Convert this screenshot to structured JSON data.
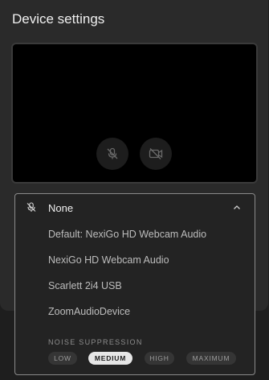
{
  "dialog": {
    "title": "Device settings"
  },
  "video_preview": {
    "mic_button_icon": "microphone-off-icon",
    "camera_button_icon": "camera-off-icon"
  },
  "microphone_dropdown": {
    "icon": "microphone-off-icon",
    "selected": "None",
    "expanded": true,
    "options": [
      "Default: NexiGo HD Webcam Audio",
      "NexiGo HD Webcam Audio",
      "Scarlett 2i4 USB",
      "ZoomAudioDevice"
    ]
  },
  "noise_suppression": {
    "heading": "NOISE SUPPRESSION",
    "levels": [
      "LOW",
      "MEDIUM",
      "HIGH",
      "MAXIMUM"
    ],
    "selected": "MEDIUM"
  }
}
